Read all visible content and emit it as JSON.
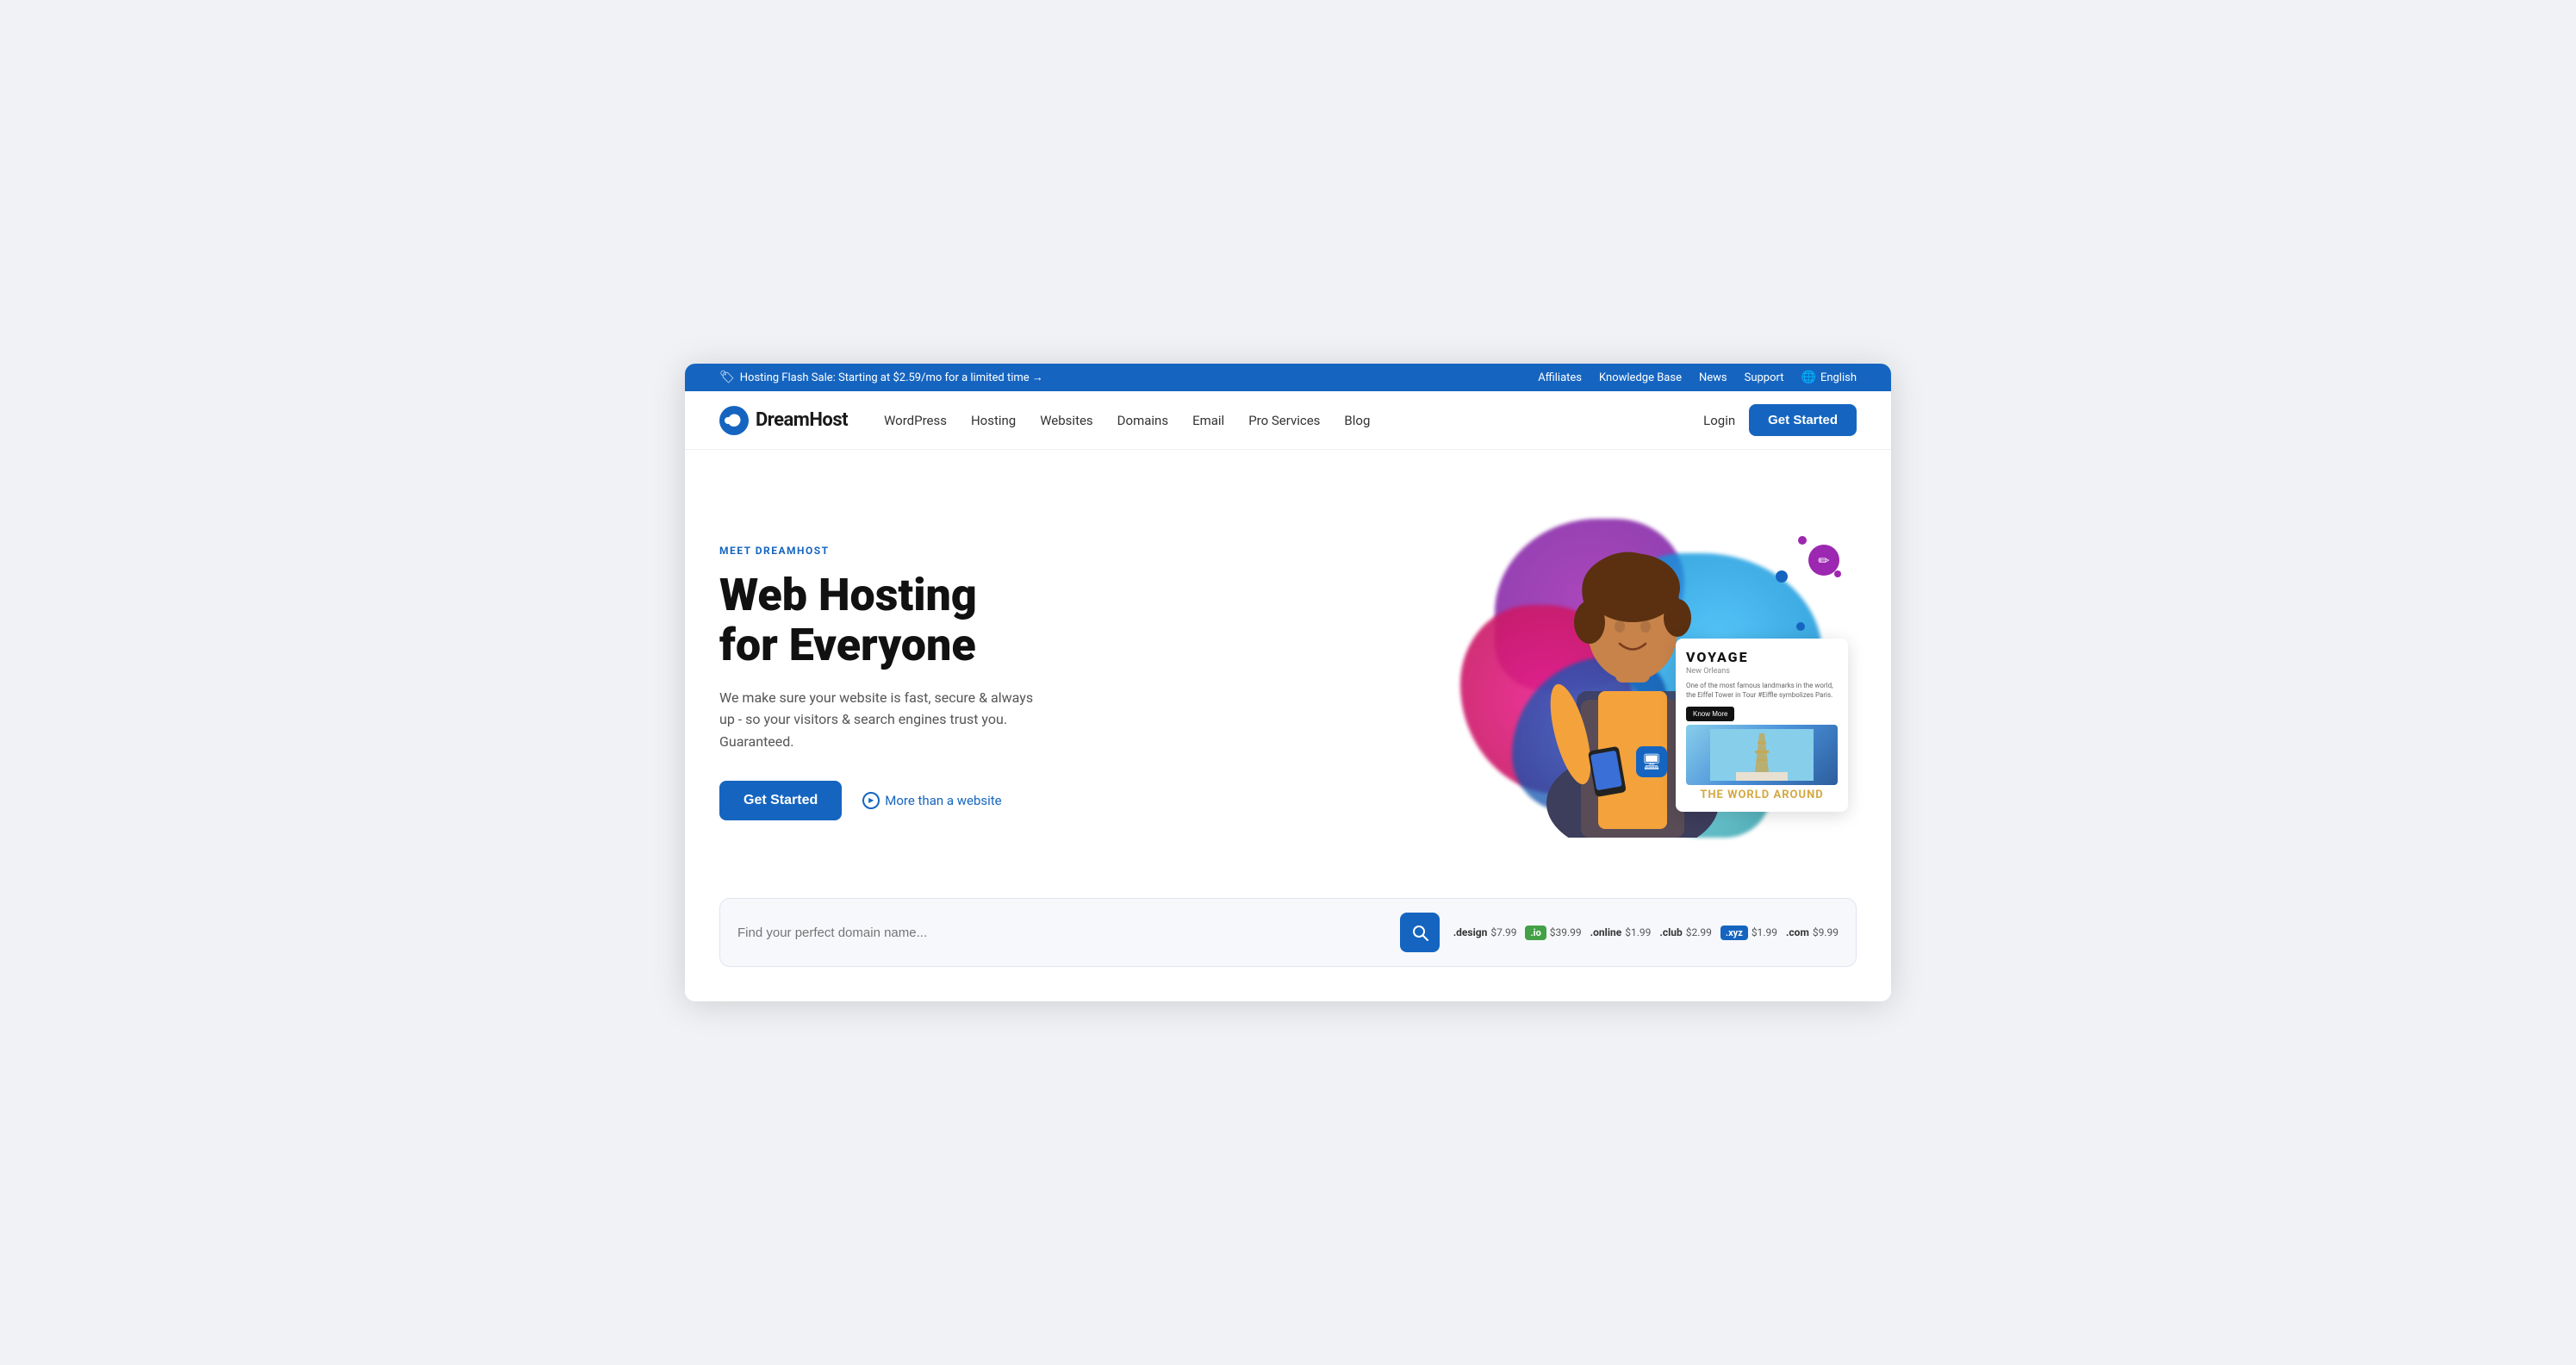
{
  "topbar": {
    "promo_text": "Hosting Flash Sale: Starting at $2.59/mo for a limited time →",
    "links": {
      "affiliates": "Affiliates",
      "knowledge_base": "Knowledge Base",
      "news": "News",
      "support": "Support",
      "language": "English"
    }
  },
  "nav": {
    "logo_text": "DreamHost",
    "links": [
      {
        "label": "WordPress",
        "id": "wordpress"
      },
      {
        "label": "Hosting",
        "id": "hosting"
      },
      {
        "label": "Websites",
        "id": "websites"
      },
      {
        "label": "Domains",
        "id": "domains"
      },
      {
        "label": "Email",
        "id": "email"
      },
      {
        "label": "Pro Services",
        "id": "pro-services"
      },
      {
        "label": "Blog",
        "id": "blog"
      }
    ],
    "login": "Login",
    "get_started": "Get Started"
  },
  "hero": {
    "meet_label": "MEET DREAMHOST",
    "title_line1": "Web Hosting",
    "title_line2": "for Everyone",
    "subtitle": "We make sure your website is fast, secure & always up - so your visitors & search engines trust you. Guaranteed.",
    "cta_button": "Get Started",
    "more_link": "More than a website"
  },
  "domain_search": {
    "placeholder": "Find your perfect domain name...",
    "button_icon": "🔍",
    "extensions": [
      {
        "name": ".design",
        "price": "$7.99",
        "type": "plain"
      },
      {
        "name": ".io",
        "price": "$39.99",
        "type": "io"
      },
      {
        "name": ".online",
        "price": "$1.99",
        "type": "plain"
      },
      {
        "name": ".club",
        "price": "$2.99",
        "type": "plain"
      },
      {
        "name": ".xyz",
        "price": "$1.99",
        "type": "xyz"
      },
      {
        "name": ".com",
        "price": "$9.99",
        "type": "plain"
      }
    ]
  },
  "voyage_card": {
    "title": "VOYAGE",
    "subtitle": "New Orleans",
    "body": "One of the most famous landmarks in the world, the Eiffel Tower in Tour #Eiffle symbolizes Paris.",
    "know_more": "Know More",
    "world_text": "THE WORLD AROUND"
  }
}
